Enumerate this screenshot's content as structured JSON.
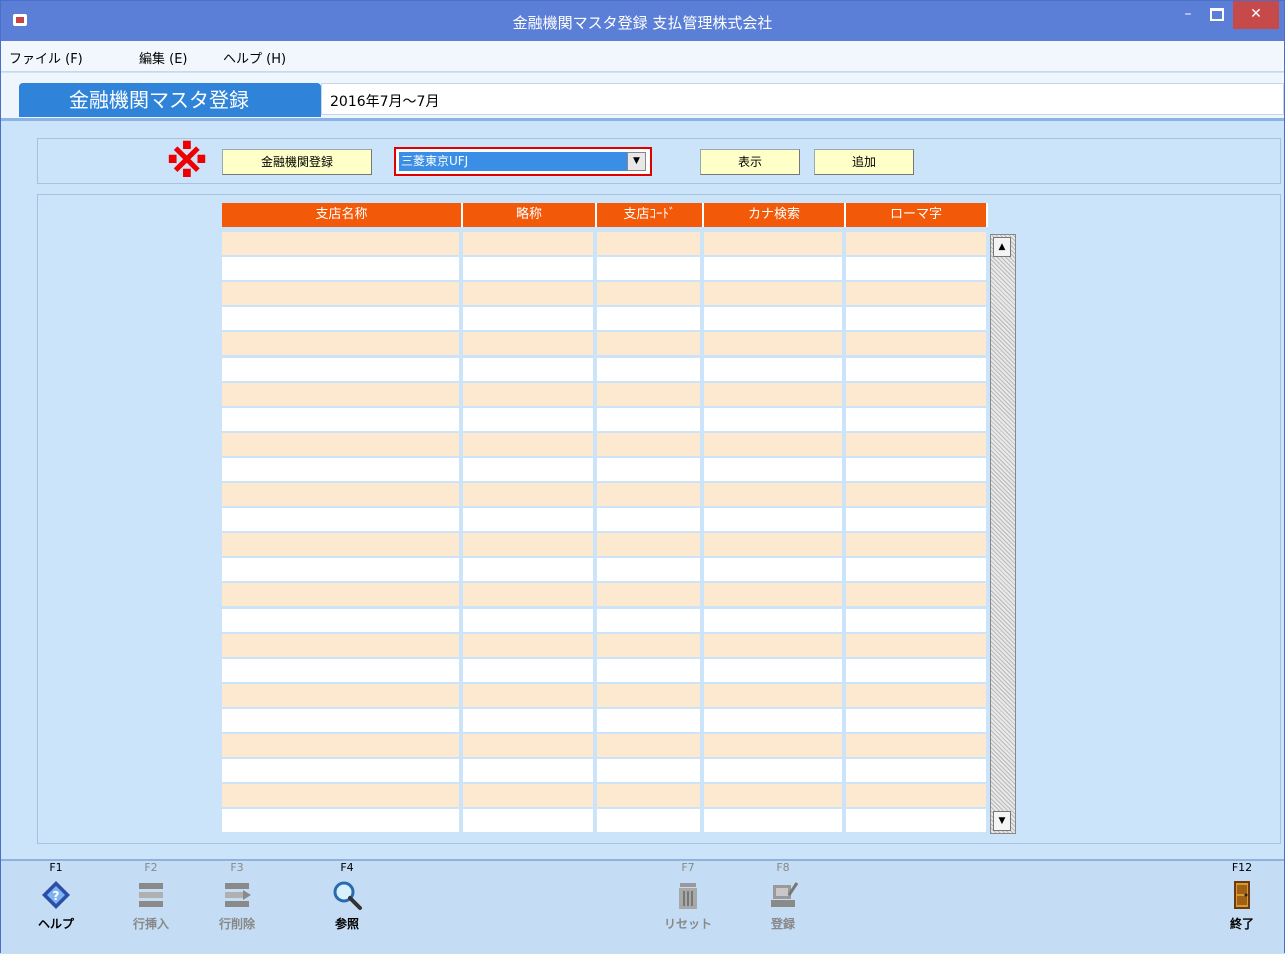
{
  "window": {
    "title": "金融機関マスタ登録 支払管理株式会社"
  },
  "menu": {
    "file": "ファイル (F)",
    "edit": "編集 (E)",
    "help": "ヘルプ (H)"
  },
  "header": {
    "page_title": "金融機関マスタ登録",
    "period": "2016年7月〜7月"
  },
  "toolbar": {
    "note_mark": "※",
    "register_bank_label": "金融機関登録",
    "bank_select_value": "三菱東京UFJ",
    "show_label": "表示",
    "add_label": "追加"
  },
  "grid": {
    "columns": [
      "支店名称",
      "略称",
      "支店ｺｰﾄﾞ",
      "カナ検索",
      "ローマ字"
    ],
    "row_count": 24,
    "colors": {
      "header": "#f25a0a",
      "odd_row": "#fde8d0",
      "even_row": "#ffffff"
    }
  },
  "footer": {
    "keys": [
      {
        "key": "F1",
        "label": "ヘルプ",
        "icon": "help-book-icon",
        "enabled": true
      },
      {
        "key": "F2",
        "label": "行挿入",
        "icon": "insert-row-icon",
        "enabled": false
      },
      {
        "key": "F3",
        "label": "行削除",
        "icon": "delete-row-icon",
        "enabled": false
      },
      {
        "key": "F4",
        "label": "参照",
        "icon": "search-icon",
        "enabled": true
      },
      {
        "key": "F7",
        "label": "リセット",
        "icon": "trash-icon",
        "enabled": false
      },
      {
        "key": "F8",
        "label": "登録",
        "icon": "register-icon",
        "enabled": false
      },
      {
        "key": "F12",
        "label": "終了",
        "icon": "exit-door-icon",
        "enabled": true
      }
    ]
  }
}
